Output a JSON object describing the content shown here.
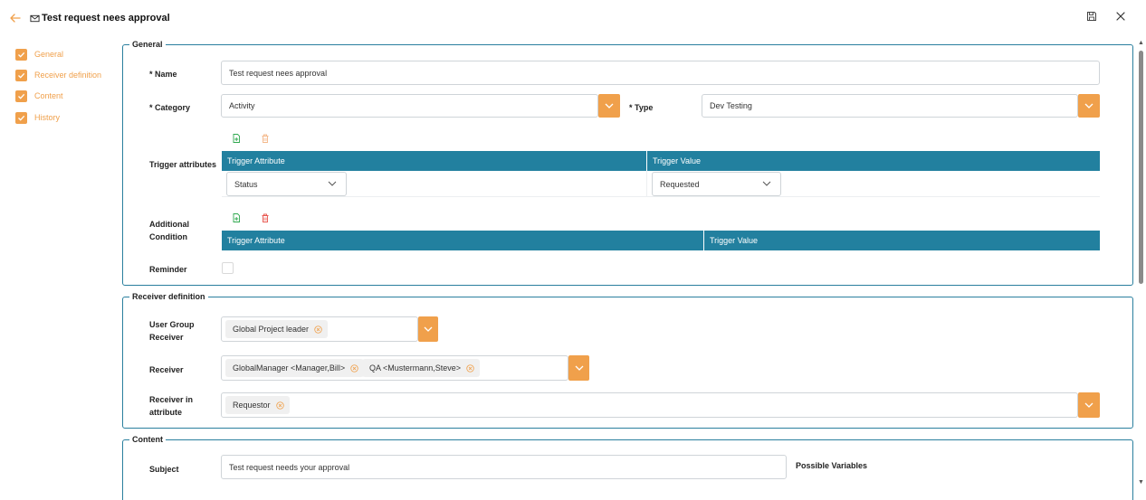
{
  "header": {
    "title": "Test request nees approval",
    "back_icon": "arrow-left-icon",
    "title_icon": "envelope-icon",
    "save_icon": "save-icon",
    "close_icon": "close-icon"
  },
  "colors": {
    "accent": "#f0a04b",
    "grid_header": "#22809f",
    "border": "#2a7f9e"
  },
  "sidebar": {
    "items": [
      {
        "label": "General",
        "checked": true
      },
      {
        "label": "Receiver definition",
        "checked": true
      },
      {
        "label": "Content",
        "checked": true
      },
      {
        "label": "History",
        "checked": true
      }
    ]
  },
  "general": {
    "legend": "General",
    "name_label": "* Name",
    "name_value": "Test request nees approval",
    "category_label": "* Category",
    "category_value": "Activity",
    "type_label": "* Type",
    "type_value": "Dev Testing",
    "trigger_label": "Trigger attributes",
    "trigger_grid": {
      "columns": [
        "Trigger Attribute",
        "Trigger Value"
      ],
      "rows": [
        {
          "attribute": "Status",
          "value": "Requested"
        }
      ]
    },
    "additional_label_line1": "Additional",
    "additional_label_line2": "Condition",
    "additional_grid": {
      "columns": [
        "Trigger Attribute",
        "Trigger Value"
      ]
    },
    "reminder_label": "Reminder",
    "reminder_checked": false
  },
  "receiver": {
    "legend": "Receiver definition",
    "user_group_label_line1": "User Group",
    "user_group_label_line2": "Receiver",
    "user_group_tags": [
      "Global Project leader"
    ],
    "receiver_label": "Receiver",
    "receiver_tags": [
      "GlobalManager <Manager,Bill>",
      "QA <Mustermann,Steve>"
    ],
    "attr_label_line1": "Receiver in",
    "attr_label_line2": "attribute",
    "attr_tags": [
      "Requestor"
    ]
  },
  "content": {
    "legend": "Content",
    "subject_label": "Subject",
    "subject_value": "Test request needs your approval",
    "possible_variables_label": "Possible Variables"
  }
}
